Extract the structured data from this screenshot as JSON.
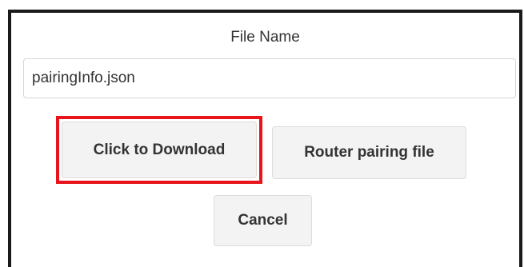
{
  "dialog": {
    "field_label": "File Name",
    "filename_value": "pairingInfo.json",
    "buttons": {
      "download": "Click to Download",
      "pairing_file": "Router pairing file",
      "cancel": "Cancel"
    }
  },
  "colors": {
    "highlight": "#e8141b",
    "button_bg": "#f3f3f3",
    "border": "#1a1a1a"
  }
}
